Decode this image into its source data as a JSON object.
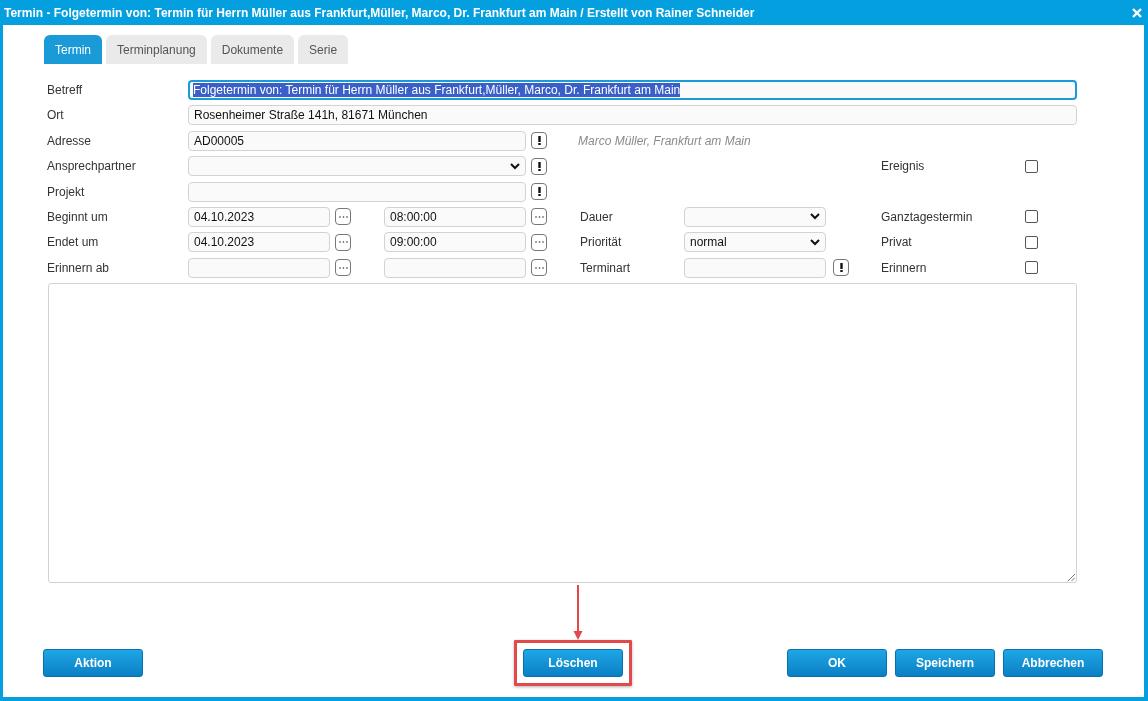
{
  "window": {
    "title": "Termin - Folgetermin von: Termin für Herrn Müller aus Frankfurt,Müller, Marco, Dr. Frankfurt am Main / Erstellt von Rainer Schneider"
  },
  "tabs": [
    {
      "label": "Termin",
      "selected": true
    },
    {
      "label": "Terminplanung",
      "selected": false
    },
    {
      "label": "Dokumente",
      "selected": false
    },
    {
      "label": "Serie",
      "selected": false
    }
  ],
  "form": {
    "betreff": {
      "label": "Betreff",
      "value": "Folgetermin von: Termin für Herrn Müller aus Frankfurt,Müller, Marco, Dr. Frankfurt am Main",
      "text_selected": true
    },
    "ort": {
      "label": "Ort",
      "value": "Rosenheimer Straße 141h, 81671 München"
    },
    "adresse": {
      "label": "Adresse",
      "value": "AD00005",
      "hint": "Marco Müller, Frankfurt am Main"
    },
    "ansprechpartner": {
      "label": "Ansprechpartner"
    },
    "projekt": {
      "label": "Projekt"
    },
    "beginnt": {
      "label": "Beginnt um",
      "date": "04.10.2023",
      "time": "08:00:00"
    },
    "endet": {
      "label": "Endet um",
      "date": "04.10.2023",
      "time": "09:00:00"
    },
    "erinnern_ab": {
      "label": "Erinnern ab"
    },
    "dauer": {
      "label": "Dauer"
    },
    "prioritaet": {
      "label": "Priorität",
      "value": "normal"
    },
    "terminart": {
      "label": "Terminart"
    },
    "options": [
      {
        "label": "Ereignis",
        "checked": false
      },
      {
        "label": "Ganztagestermin",
        "checked": false
      },
      {
        "label": "Privat",
        "checked": false
      },
      {
        "label": "Erinnern",
        "checked": false
      }
    ]
  },
  "buttons": [
    {
      "label": "Aktion",
      "highlighted": false
    },
    {
      "label": "Löschen",
      "highlighted": true
    },
    {
      "label": "OK",
      "highlighted": false
    },
    {
      "label": "Speichern",
      "highlighted": false
    },
    {
      "label": "Abbrechen",
      "highlighted": false
    }
  ]
}
